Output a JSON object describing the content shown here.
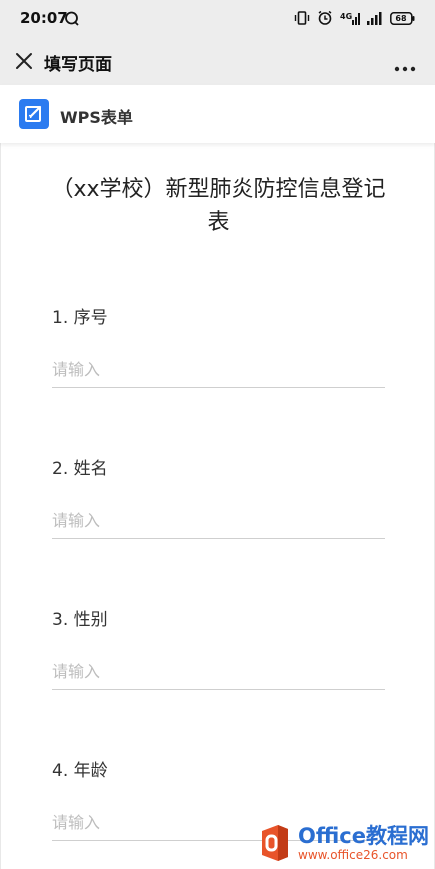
{
  "status_bar": {
    "time": "20:07",
    "icons": [
      "chat-bubble-icon",
      "vibrate-icon",
      "alarm-icon",
      "signal-4g-icon",
      "signal-icon",
      "battery-icon"
    ],
    "battery_level": "68"
  },
  "title_bar": {
    "title": "填写页面",
    "close_icon": "close-icon",
    "more_icon": "more-dots-icon"
  },
  "brand": {
    "name": "WPS表单",
    "logo_icon": "form-edit-icon",
    "logo_color": "#2b7bf0"
  },
  "form": {
    "title": "（xx学校）新型肺炎防控信息登记表",
    "fields": [
      {
        "label": "1. 序号",
        "placeholder": "请输入"
      },
      {
        "label": "2. 姓名",
        "placeholder": "请输入"
      },
      {
        "label": "3. 性别",
        "placeholder": "请输入"
      },
      {
        "label": "4. 年龄",
        "placeholder": "请输入"
      }
    ]
  },
  "watermark": {
    "title": "Office教程网",
    "url": "www.office26.com"
  }
}
